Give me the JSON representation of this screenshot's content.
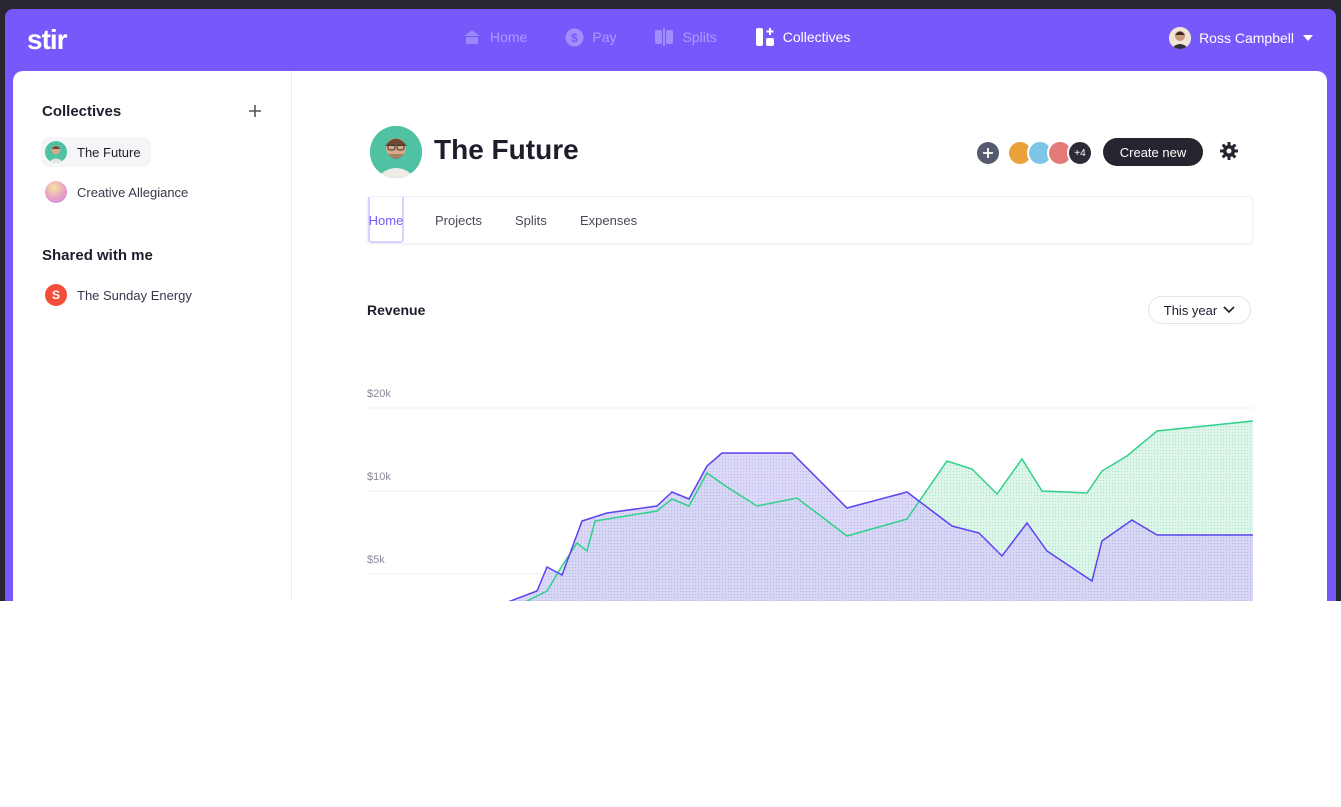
{
  "app": {
    "logo": "stir",
    "nav": [
      {
        "label": "Home",
        "icon": "home-icon",
        "active": false
      },
      {
        "label": "Pay",
        "icon": "dollar-icon",
        "active": false
      },
      {
        "label": "Splits",
        "icon": "splits-icon",
        "active": false
      },
      {
        "label": "Collectives",
        "icon": "collectives-icon",
        "active": true
      }
    ],
    "user": {
      "name": "Ross Campbell"
    }
  },
  "sidebar": {
    "collectives_title": "Collectives",
    "collectives": [
      {
        "label": "The Future",
        "selected": true
      },
      {
        "label": "Creative Allegiance",
        "selected": false
      }
    ],
    "shared_title": "Shared with me",
    "shared": [
      {
        "label": "The Sunday Energy",
        "initial": "S",
        "color": "#f24e3a"
      }
    ]
  },
  "collective": {
    "title": "The Future",
    "members_more": "+4",
    "create_button": "Create new"
  },
  "tabs": [
    {
      "label": "Home",
      "active": true
    },
    {
      "label": "Projects",
      "active": false
    },
    {
      "label": "Splits",
      "active": false
    },
    {
      "label": "Expenses",
      "active": false
    }
  ],
  "revenue": {
    "title": "Revenue",
    "range": "This year"
  },
  "colors": {
    "brand": "#7759fb",
    "green_series": "#2fd08a",
    "purple_series": "#5a43f0"
  },
  "chart_data": {
    "type": "area",
    "title": "Revenue",
    "yticks": [
      "$20k",
      "$10k",
      "$5k"
    ],
    "ylim": [
      0,
      20000
    ],
    "x": [
      0,
      1,
      2,
      3,
      4,
      5,
      6,
      7,
      8,
      9,
      10,
      11,
      12,
      13,
      14,
      15,
      16,
      17,
      18,
      19,
      20,
      21,
      22,
      23,
      24,
      25,
      26,
      27,
      28,
      29,
      30,
      31,
      32,
      33,
      34,
      35,
      36,
      37,
      38,
      39,
      40,
      41,
      42,
      43,
      44,
      45,
      46,
      47,
      48,
      49,
      50,
      51,
      52,
      53,
      54,
      55,
      56,
      57,
      58,
      59
    ],
    "series": [
      {
        "name": "",
        "values": [
          null,
          null,
          null,
          null,
          null,
          null,
          null,
          null,
          null,
          null,
          null,
          null,
          null,
          null,
          null,
          null,
          null,
          null,
          null,
          null,
          null,
          null,
          null,
          null,
          null,
          null,
          null,
          null,
          null,
          null,
          null,
          null,
          null,
          null,
          null,
          null,
          null,
          null,
          null,
          null,
          null,
          null,
          null,
          null,
          null,
          null,
          null,
          null,
          null,
          null,
          null,
          null,
          null,
          null,
          null,
          null,
          null,
          null,
          null,
          null
        ]
      }
    ]
  }
}
